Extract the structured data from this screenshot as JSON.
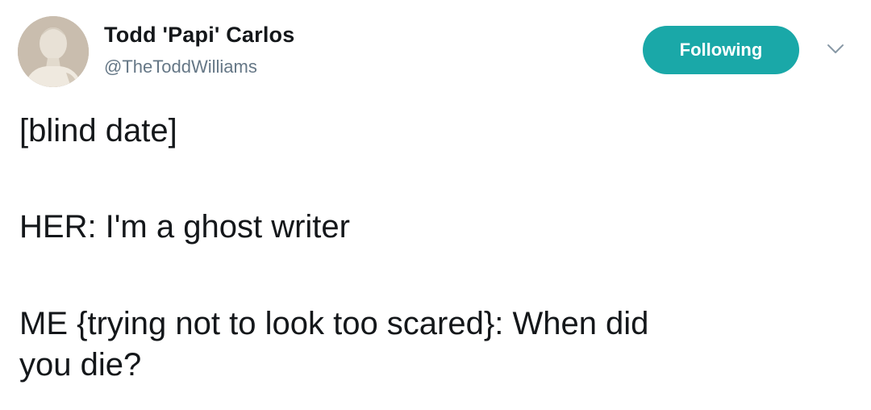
{
  "author": {
    "display_name": "Todd 'Papi' Carlos",
    "handle": "@TheToddWilliams",
    "avatar_icon": "statue-bust-avatar"
  },
  "follow_button": {
    "label": "Following",
    "color": "#1aa8a8"
  },
  "menu": {
    "icon": "chevron-down-icon"
  },
  "tweet": {
    "lines": [
      "[blind date]",
      "HER: I'm a ghost writer",
      "ME {trying not to look too scared}: When did",
      "you die?"
    ]
  }
}
